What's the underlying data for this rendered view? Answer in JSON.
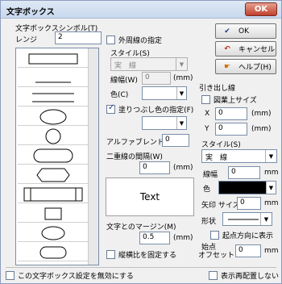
{
  "window": {
    "title": "文字ボックス",
    "close_label": "OK"
  },
  "symbol_group": {
    "label": "文字ボックスシンボル(T)",
    "range_label": "レンジ",
    "range_value": "2"
  },
  "outer_line": {
    "checkbox_label": "外周線の指定",
    "style_label": "スタイル(S)",
    "style_value": "実　線",
    "width_label": "線幅(W)",
    "width_value": "0",
    "width_unit": "(mm)",
    "color_label": "色(C)"
  },
  "fill": {
    "checkbox_label": "塗りつぶし色の指定(F)"
  },
  "alpha": {
    "label": "アルファブレンド",
    "value": "0"
  },
  "double_line": {
    "label": "二重線の間隔(W)",
    "value": "0",
    "unit": "(mm)"
  },
  "preview": {
    "text": "Text"
  },
  "margin": {
    "label": "文字とのマージン(M)",
    "value": "0.5",
    "unit": "(mm)"
  },
  "aspect": {
    "checkbox_label": "縦横比を固定する"
  },
  "buttons": {
    "ok": "OK",
    "cancel": "キャンセル",
    "help": "ヘルプ(H)"
  },
  "leader": {
    "title": "引き出し線",
    "drawing_size_label": "図業上サイズ",
    "x_label": "X",
    "x_value": "0",
    "x_unit": "(mm)",
    "y_label": "Y",
    "y_value": "0",
    "y_unit": "(mm)",
    "style_label": "スタイル(S)",
    "style_value": "実　線",
    "width_label": "線幅",
    "width_value": "0",
    "width_unit": "mm",
    "color_label": "色",
    "arrow_label": "矢印 サイズ",
    "arrow_value": "0",
    "arrow_unit": "mm",
    "shape_label": "形状",
    "start_dir_label": "起点方向に表示",
    "offset_label_1": "始点",
    "offset_label_2": "オフセット",
    "offset_value": "0",
    "offset_unit": "mm"
  },
  "footer": {
    "disable_label": "この文字ボックス設定を無効にする",
    "no_relocate_label": "表示再配置しない"
  },
  "colors": {
    "fill_color": "#ffffff",
    "leader_color": "#000000",
    "accent": "#1a3c8a"
  }
}
